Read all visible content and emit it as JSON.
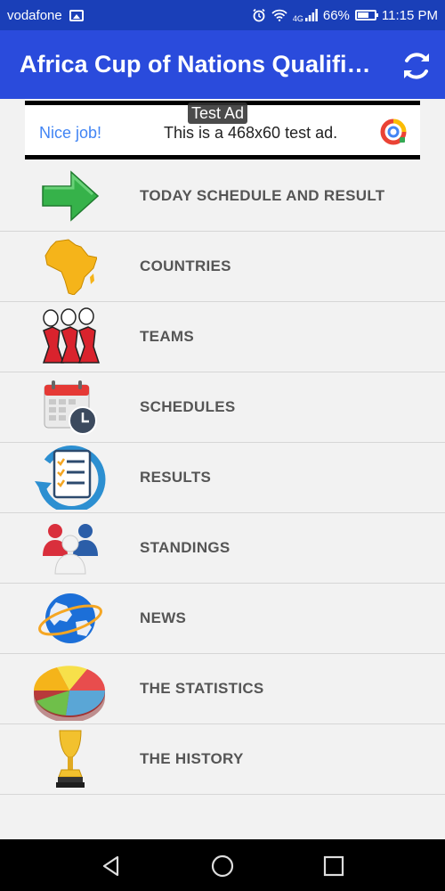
{
  "status_bar": {
    "carrier": "vodafone",
    "network": "4G",
    "battery": "66%",
    "time": "11:15 PM"
  },
  "app_bar": {
    "title": "Africa Cup of Nations Qualific...",
    "refresh_icon": "refresh-icon"
  },
  "ad": {
    "badge": "Test Ad",
    "nice_job": "Nice job!",
    "text": "This is a 468x60 test ad."
  },
  "menu": {
    "items": [
      {
        "label": "TODAY SCHEDULE AND RESULT",
        "icon": "green-arrow-icon"
      },
      {
        "label": "COUNTRIES",
        "icon": "africa-map-icon"
      },
      {
        "label": "TEAMS",
        "icon": "players-icon"
      },
      {
        "label": "SCHEDULES",
        "icon": "calendar-clock-icon"
      },
      {
        "label": "RESULTS",
        "icon": "checklist-icon"
      },
      {
        "label": "STANDINGS",
        "icon": "people-group-icon"
      },
      {
        "label": "NEWS",
        "icon": "globe-icon"
      },
      {
        "label": "THE STATISTICS",
        "icon": "pie-chart-icon"
      },
      {
        "label": "THE HISTORY",
        "icon": "trophy-icon"
      }
    ]
  },
  "nav_bar": {
    "icons": [
      "back-triangle-icon",
      "home-circle-icon",
      "recents-square-icon"
    ]
  },
  "colors": {
    "status_bar": "#1a3fb8",
    "app_bar": "#2a4bdc",
    "background": "#f2f2f2",
    "label": "#555555"
  }
}
